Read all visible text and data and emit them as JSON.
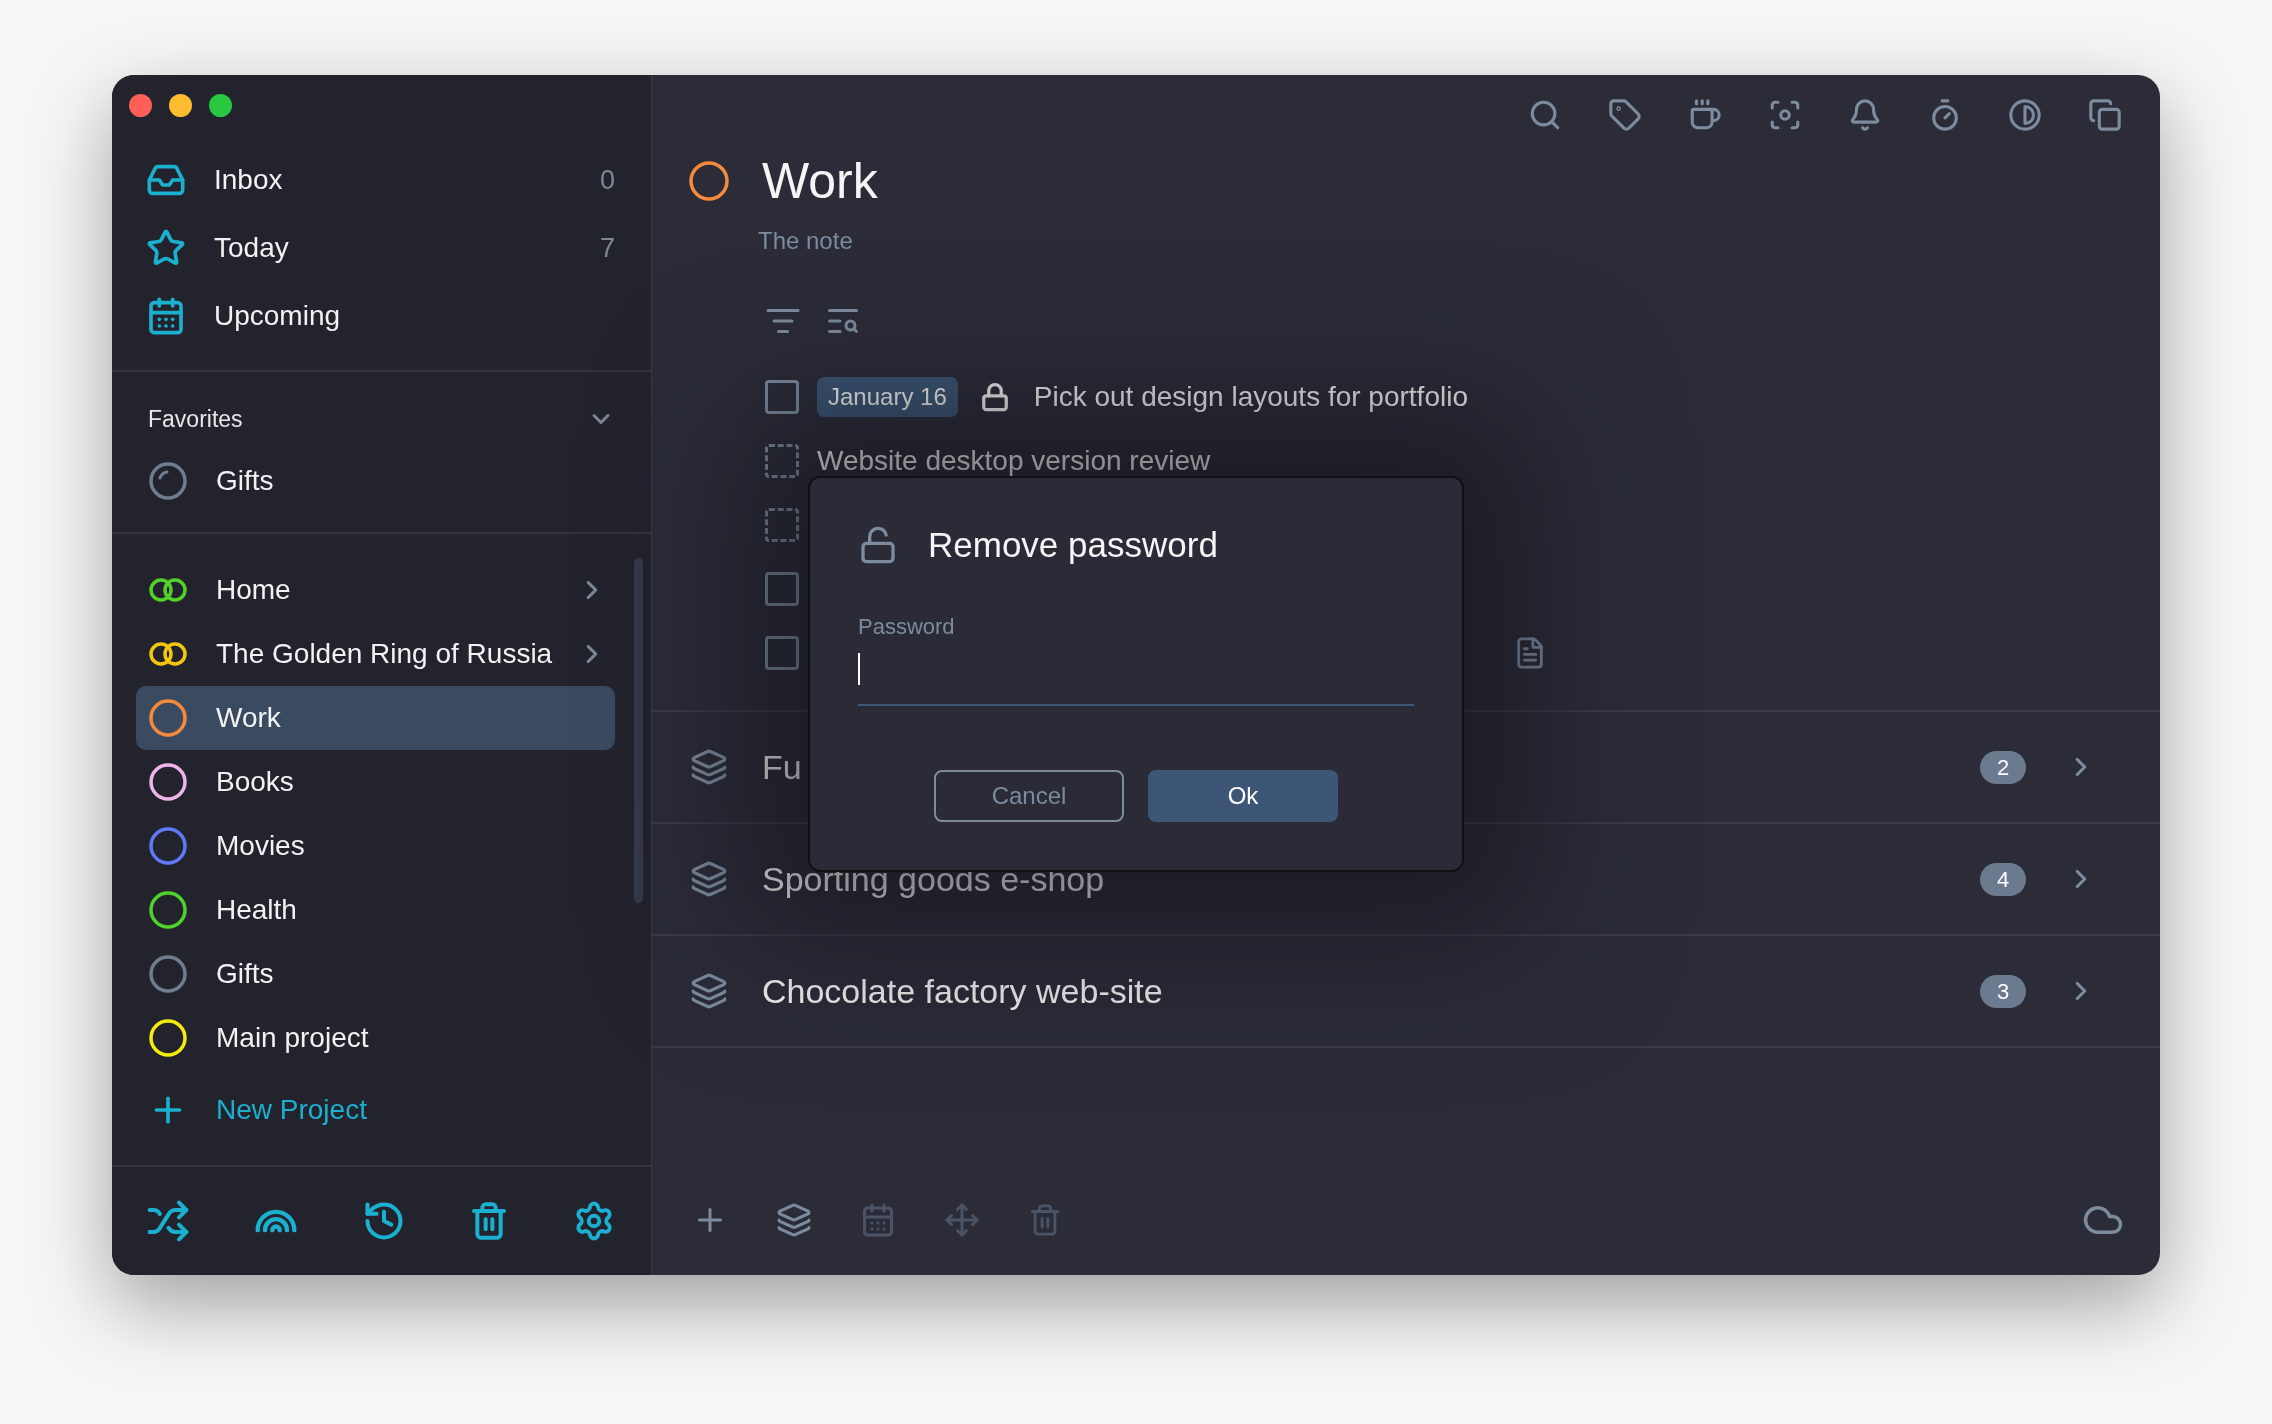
{
  "sidebar": {
    "nav": [
      {
        "label": "Inbox",
        "count": "0"
      },
      {
        "label": "Today",
        "count": "7"
      },
      {
        "label": "Upcoming"
      }
    ],
    "favorites": {
      "title": "Favorites",
      "expanded": true,
      "items": [
        {
          "label": "Gifts",
          "kind": "progress"
        }
      ]
    },
    "projects": [
      {
        "label": "Home",
        "kind": "group",
        "color": "#52d12a",
        "expandable": true,
        "selected": false
      },
      {
        "label": "The Golden Ring of Russia",
        "kind": "group",
        "color": "#f5c60e",
        "expandable": true,
        "selected": false
      },
      {
        "label": "Work",
        "kind": "project",
        "color": "#f58a3c",
        "expandable": false,
        "selected": true
      },
      {
        "label": "Books",
        "kind": "project",
        "color": "#f0b4ea",
        "expandable": false,
        "selected": false
      },
      {
        "label": "Movies",
        "kind": "project",
        "color": "#5f78f5",
        "expandable": false,
        "selected": false
      },
      {
        "label": "Health",
        "kind": "project",
        "color": "#52d12a",
        "expandable": false,
        "selected": false
      },
      {
        "label": "Gifts",
        "kind": "project",
        "color": "#6f7d8f",
        "expandable": false,
        "selected": false
      },
      {
        "label": "Main project",
        "kind": "project",
        "color": "#f5ec0e",
        "expandable": false,
        "selected": false
      }
    ],
    "new_project": "New Project"
  },
  "project": {
    "title": "Work",
    "color": "#f58a3c",
    "note": "The note"
  },
  "tasks": [
    {
      "kind": "checkbox",
      "checked": false,
      "date": "January 16",
      "locked": true,
      "title": "Pick out design layouts for portfolio",
      "has_note": false
    },
    {
      "kind": "dashed",
      "checked": false,
      "locked": false,
      "title": "Website desktop version review",
      "has_note": false
    },
    {
      "kind": "dashed",
      "checked": false,
      "locked": false,
      "has_note": false
    },
    {
      "kind": "checkbox",
      "checked": false,
      "locked": false,
      "has_note": false
    },
    {
      "kind": "checkbox",
      "checked": false,
      "locked": false,
      "has_note": true
    }
  ],
  "sections": [
    {
      "name": "Fu",
      "count": "2"
    },
    {
      "name": "Sporting goods e-shop",
      "count": "4"
    },
    {
      "name": "Chocolate factory web-site",
      "count": "3"
    }
  ],
  "dialog": {
    "title": "Remove password",
    "field_label": "Password",
    "buttons": [
      "Cancel",
      "Ok"
    ]
  }
}
